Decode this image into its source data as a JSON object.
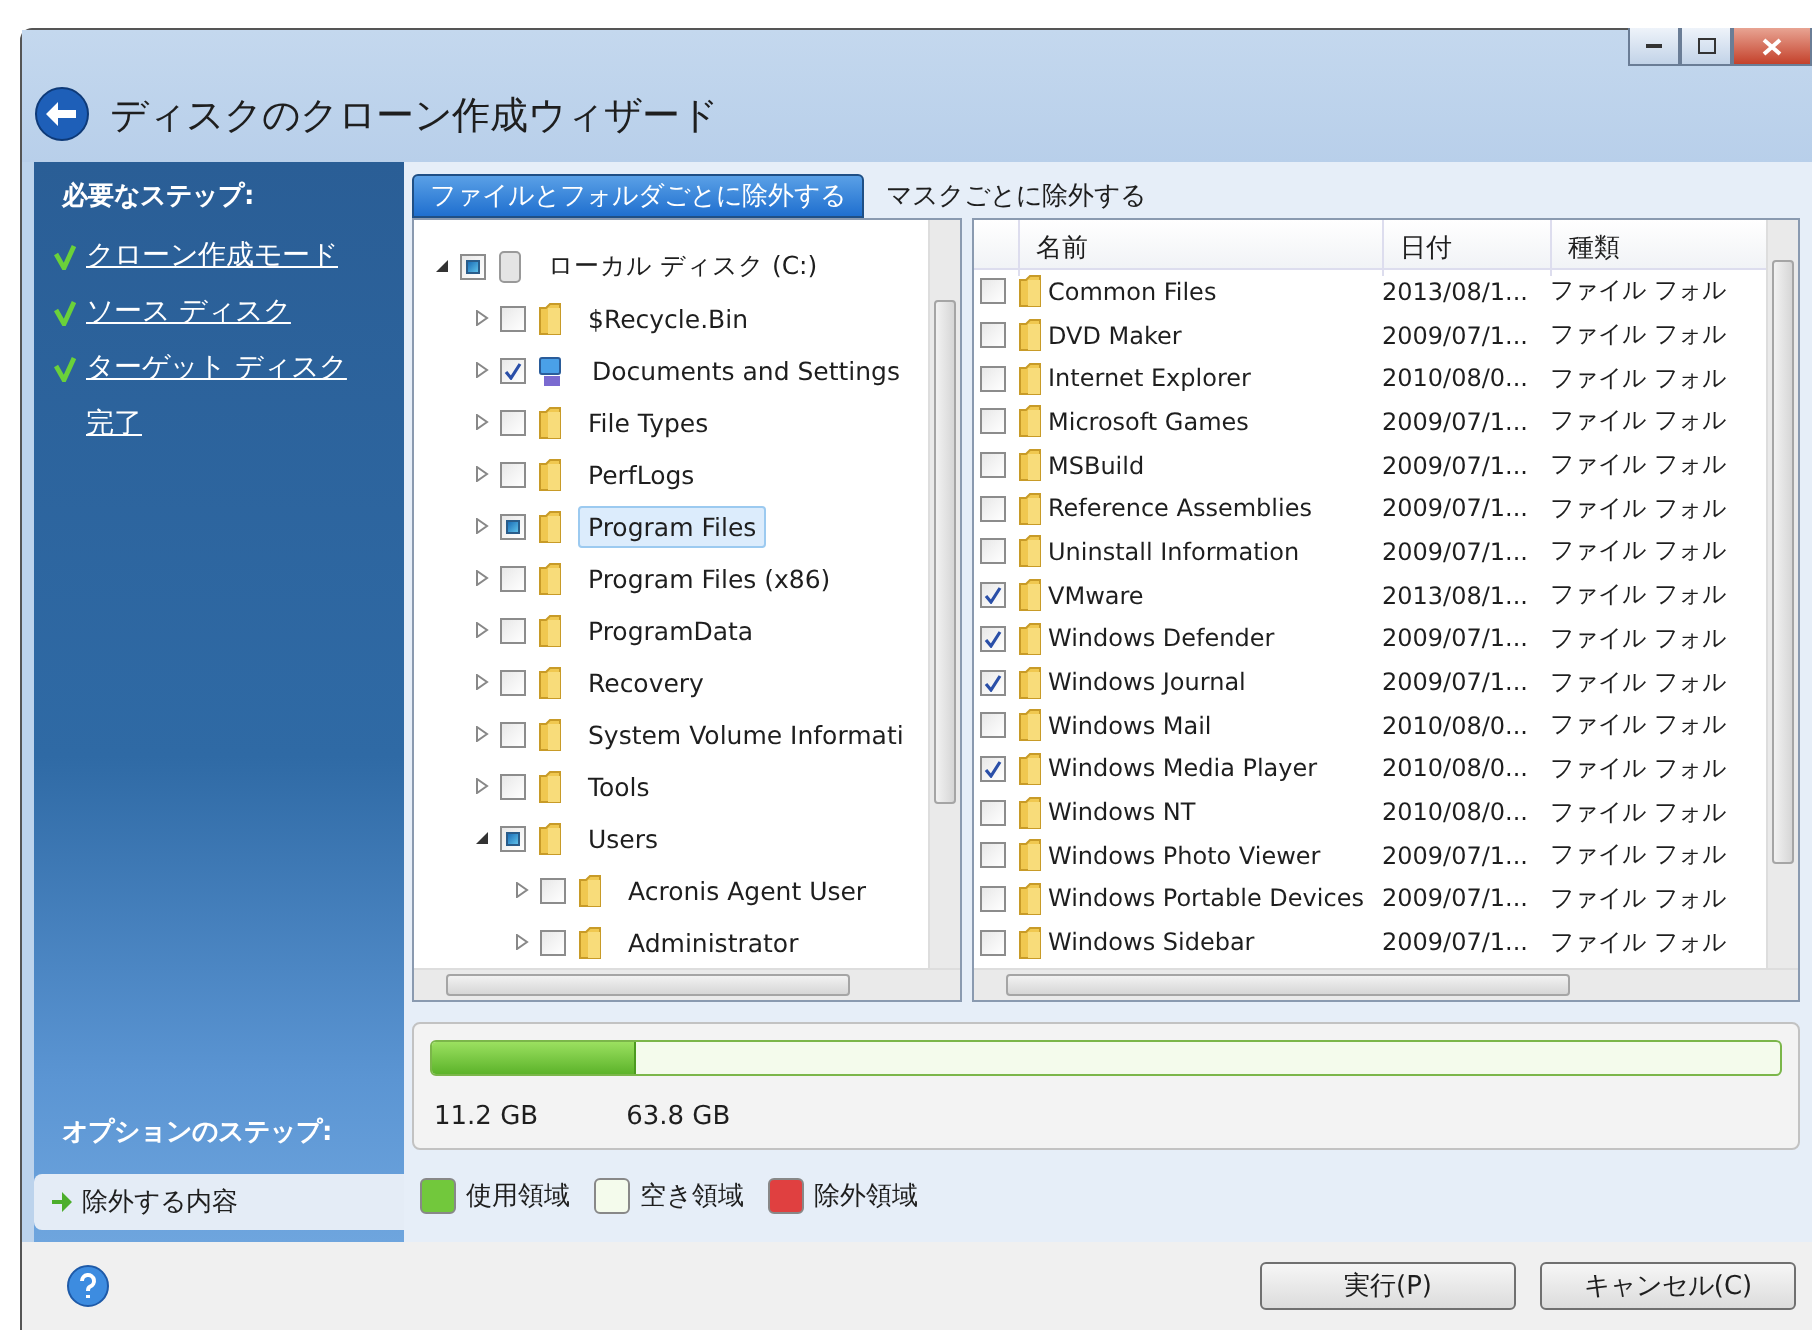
{
  "window": {
    "title": "ディスクのクローン作成ウィザード"
  },
  "sidebar": {
    "required_heading": "必要なステップ:",
    "required_steps": [
      {
        "label": "クローン作成モード",
        "done": true
      },
      {
        "label": "ソース ディスク",
        "done": true
      },
      {
        "label": "ターゲット ディスク",
        "done": true
      },
      {
        "label": "完了",
        "done": false
      }
    ],
    "optional_heading": "オプションのステップ:",
    "optional_steps": [
      {
        "label": "除外する内容",
        "selected": true
      }
    ]
  },
  "tabs": [
    {
      "label": "ファイルとフォルダごとに除外する",
      "selected": true
    },
    {
      "label": "マスクごとに除外する",
      "selected": false
    }
  ],
  "tree": [
    {
      "label": "ローカル ディスク (C:)",
      "kind": "drive",
      "partial": true,
      "expanded": true,
      "selected": false,
      "children": [
        {
          "label": "$Recycle.Bin",
          "kind": "folder",
          "checked": false,
          "expanded": false,
          "selected": false
        },
        {
          "label": "Documents and Settings",
          "kind": "shortcut",
          "checked": true,
          "expanded": false,
          "selected": false
        },
        {
          "label": "File Types",
          "kind": "folder",
          "checked": false,
          "expanded": false,
          "selected": false
        },
        {
          "label": "PerfLogs",
          "kind": "folder",
          "checked": false,
          "expanded": false,
          "selected": false
        },
        {
          "label": "Program Files",
          "kind": "folder",
          "partial": true,
          "expanded": false,
          "selected": true
        },
        {
          "label": "Program Files (x86)",
          "kind": "folder",
          "checked": false,
          "expanded": false,
          "selected": false
        },
        {
          "label": "ProgramData",
          "kind": "folder",
          "checked": false,
          "expanded": false,
          "selected": false
        },
        {
          "label": "Recovery",
          "kind": "folder",
          "checked": false,
          "expanded": false,
          "selected": false
        },
        {
          "label": "System Volume Informati",
          "kind": "folder",
          "checked": false,
          "expanded": false,
          "selected": false
        },
        {
          "label": "Tools",
          "kind": "folder",
          "checked": false,
          "expanded": false,
          "selected": false
        },
        {
          "label": "Users",
          "kind": "folder",
          "partial": true,
          "expanded": true,
          "selected": false,
          "children": [
            {
              "label": "Acronis Agent User",
              "kind": "folder",
              "checked": false,
              "expanded": false,
              "selected": false
            },
            {
              "label": "Administrator",
              "kind": "folder",
              "checked": false,
              "expanded": false,
              "selected": false
            }
          ]
        }
      ]
    }
  ],
  "file_list": {
    "columns": [
      "名前",
      "日付",
      "種類"
    ],
    "rows": [
      {
        "name": "Common Files",
        "date": "2013/08/1...",
        "type": "ファイル フォル",
        "checked": false
      },
      {
        "name": "DVD Maker",
        "date": "2009/07/1...",
        "type": "ファイル フォル",
        "checked": false
      },
      {
        "name": "Internet Explorer",
        "date": "2010/08/0...",
        "type": "ファイル フォル",
        "checked": false
      },
      {
        "name": "Microsoft Games",
        "date": "2009/07/1...",
        "type": "ファイル フォル",
        "checked": false
      },
      {
        "name": "MSBuild",
        "date": "2009/07/1...",
        "type": "ファイル フォル",
        "checked": false
      },
      {
        "name": "Reference Assemblies",
        "date": "2009/07/1...",
        "type": "ファイル フォル",
        "checked": false
      },
      {
        "name": "Uninstall Information",
        "date": "2009/07/1...",
        "type": "ファイル フォル",
        "checked": false
      },
      {
        "name": "VMware",
        "date": "2013/08/1...",
        "type": "ファイル フォル",
        "checked": true
      },
      {
        "name": "Windows Defender",
        "date": "2009/07/1...",
        "type": "ファイル フォル",
        "checked": true
      },
      {
        "name": "Windows Journal",
        "date": "2009/07/1...",
        "type": "ファイル フォル",
        "checked": true
      },
      {
        "name": "Windows Mail",
        "date": "2010/08/0...",
        "type": "ファイル フォル",
        "checked": false
      },
      {
        "name": "Windows Media Player",
        "date": "2010/08/0...",
        "type": "ファイル フォル",
        "checked": true
      },
      {
        "name": "Windows NT",
        "date": "2010/08/0...",
        "type": "ファイル フォル",
        "checked": false
      },
      {
        "name": "Windows Photo Viewer",
        "date": "2009/07/1...",
        "type": "ファイル フォル",
        "checked": false
      },
      {
        "name": "Windows Portable Devices",
        "date": "2009/07/1...",
        "type": "ファイル フォル",
        "checked": false
      },
      {
        "name": "Windows Sidebar",
        "date": "2009/07/1...",
        "type": "ファイル フォル",
        "checked": false
      }
    ]
  },
  "usage": {
    "level": 0.15,
    "used": "11.2 GB",
    "total": "63.8 GB"
  },
  "legend": [
    {
      "label": "使用領域",
      "color": "#72c83c"
    },
    {
      "label": "空き領域",
      "color": "#f4fbec"
    },
    {
      "label": "除外領域",
      "color": "#e04040"
    }
  ],
  "buttons": [
    {
      "label": "実行(P)"
    },
    {
      "label": "キャンセル(C)"
    }
  ]
}
